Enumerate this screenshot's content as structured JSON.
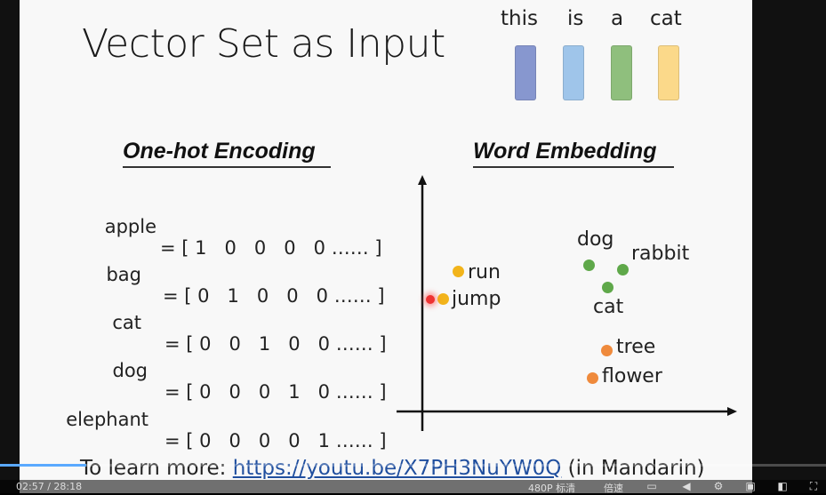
{
  "slide": {
    "title": "Vector Set as Input",
    "tokens": [
      {
        "word": "this",
        "color": "#8797cf"
      },
      {
        "word": "is",
        "color": "#9fc5ea"
      },
      {
        "word": "a",
        "color": "#8fbf7d"
      },
      {
        "word": "cat",
        "color": "#fbd98a"
      }
    ],
    "one_hot": {
      "heading": "One-hot Encoding",
      "rows": [
        {
          "word": "apple",
          "vector": "= [ 1   0   0   0   0 …… ]"
        },
        {
          "word": "bag",
          "vector": "= [ 0   1   0   0   0 …… ]"
        },
        {
          "word": "cat",
          "vector": "= [ 0   0   1   0   0 …… ]"
        },
        {
          "word": "dog",
          "vector": "= [ 0   0   0   1   0 …… ]"
        },
        {
          "word": "elephant",
          "vector": "= [ 0   0   0   0   1 …… ]"
        }
      ]
    },
    "embedding": {
      "heading": "Word Embedding",
      "points": [
        {
          "label": "run",
          "color": "#f2b41b"
        },
        {
          "label": "jump",
          "color": "#f2b41b"
        },
        {
          "label": "dog",
          "color": "#5fa84a"
        },
        {
          "label": "rabbit",
          "color": "#5fa84a"
        },
        {
          "label": "cat",
          "color": "#5fa84a"
        },
        {
          "label": "tree",
          "color": "#ef8a3c"
        },
        {
          "label": "flower",
          "color": "#ef8a3c"
        }
      ]
    },
    "footer": {
      "prefix": "To learn more: ",
      "link": "https://youtu.be/X7PH3NuYW0Q",
      "suffix": " (in Mandarin)"
    }
  },
  "player": {
    "time_current": "02:57",
    "time_separator": "/",
    "time_total": "28:18",
    "progress": 0.104,
    "quality": "480P 标清",
    "speed": "倍速",
    "icons": [
      "subtitle-icon",
      "volume-icon",
      "settings-icon",
      "pip-icon",
      "widescreen-icon",
      "fullscreen-icon"
    ]
  }
}
